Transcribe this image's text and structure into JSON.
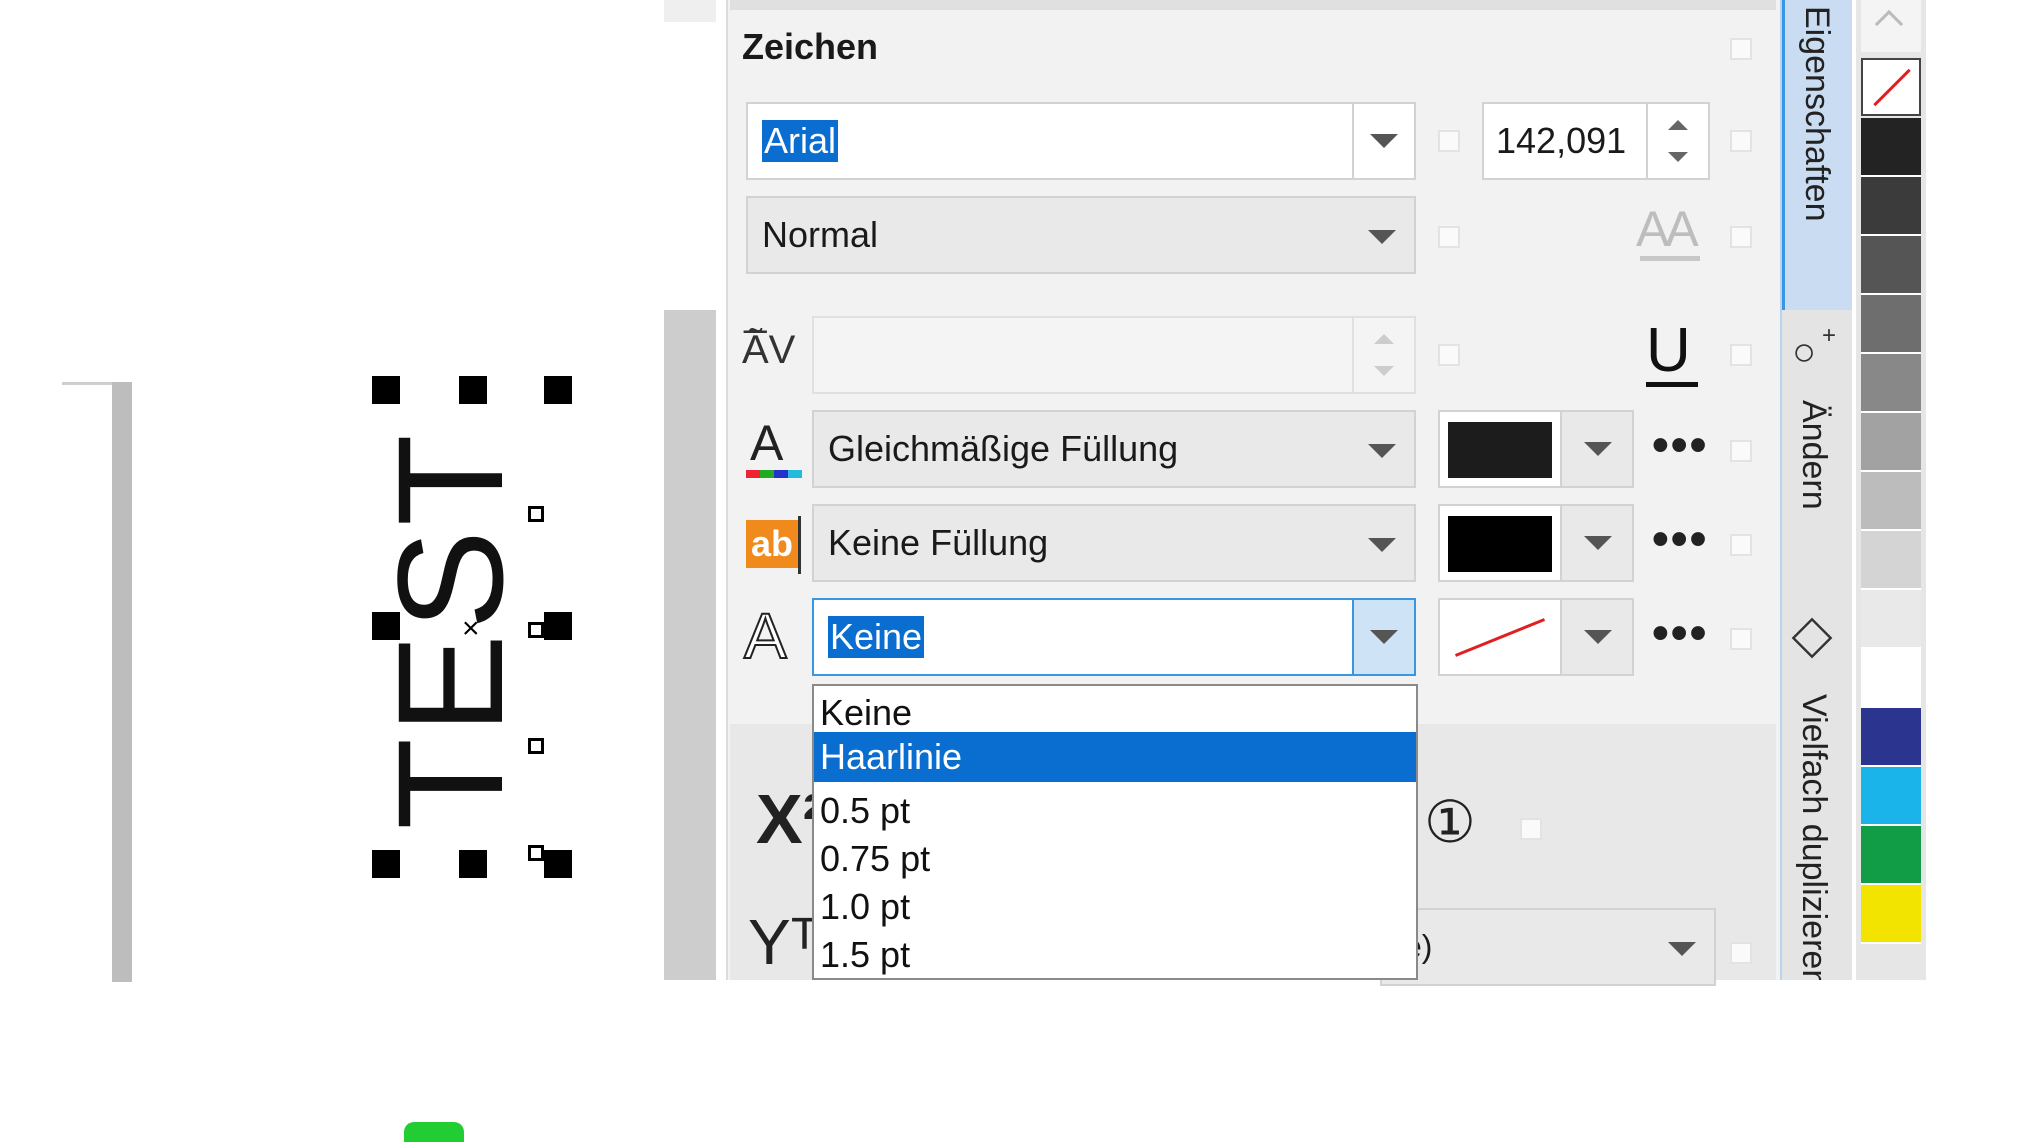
{
  "panel": {
    "section_title": "Zeichen",
    "font_name": "Arial",
    "font_size": "142,091",
    "font_style": "Normal",
    "fill_type": "Gleichmäßige Füllung",
    "background_fill": "Keine Füllung",
    "outline_width": "Keine",
    "fill_color": "#1c1c1c",
    "bg_fill_color": "#000000",
    "partial_row_text": "e)",
    "icons": {
      "kerning": "Ã̅V",
      "text_fill": "A",
      "bg_fill": "ab",
      "outline": "A",
      "superscript": "X²",
      "baseline": "Yᵀ",
      "ordinal": "①",
      "underline": "U",
      "caps": "AA"
    }
  },
  "dropdown": {
    "options": [
      "Keine",
      "Haarlinie",
      "0.5 pt",
      "0.75 pt",
      "1.0 pt",
      "1.5 pt"
    ],
    "highlighted": "Haarlinie"
  },
  "side_tabs": {
    "properties": "Eigenschaften",
    "change": "Ändern",
    "duplicate": "Vielfach duplizieren"
  },
  "canvas": {
    "text_object": "TEST"
  },
  "palette": {
    "colors": [
      "#232323",
      "#3b3b3b",
      "#555555",
      "#6e6e6e",
      "#888888",
      "#a2a2a2",
      "#bcbcbc",
      "#d4d4d4",
      "#e9e9e9",
      "#ffffff",
      "#2b3590",
      "#1ab4ea",
      "#119c46",
      "#f3e400"
    ]
  }
}
